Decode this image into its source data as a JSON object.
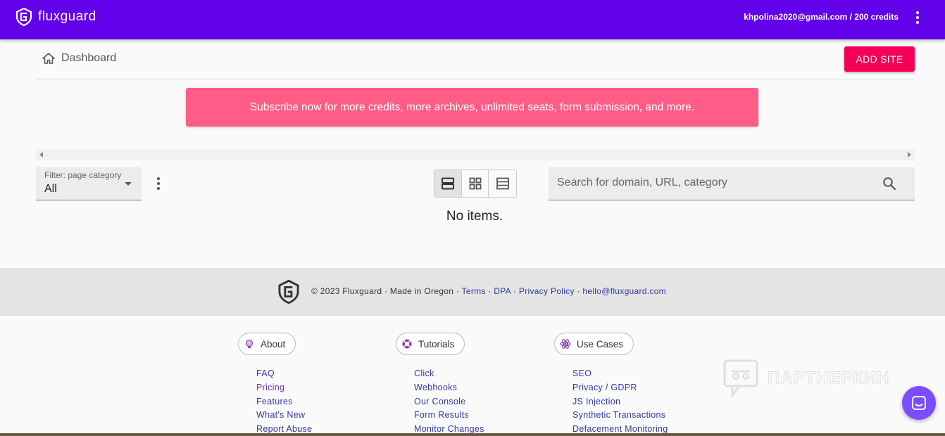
{
  "header": {
    "brand": "fluxguard",
    "account": "khpolina2020@gmail.com / 200 credits",
    "menu_icon": "more-vert-icon"
  },
  "breadcrumb": {
    "icon": "home-icon",
    "label": "Dashboard"
  },
  "actions": {
    "add_site": "ADD SITE"
  },
  "banner": {
    "text": "Subscribe now for more credits, more archives, unlimited seats, form submission, and more."
  },
  "filter": {
    "label": "Filter: page category",
    "value": "All"
  },
  "views": {
    "active": "list-view",
    "icons": [
      "list-view-icon",
      "grid-view-icon",
      "table-view-icon"
    ]
  },
  "search": {
    "placeholder": "Search for domain, URL, category",
    "value": ""
  },
  "empty_state": "No items.",
  "footer": {
    "copyright": "© 2023 Fluxguard · Made in Oregon ·",
    "links": [
      "Terms",
      "DPA",
      "Privacy Policy",
      "hello@fluxguard.com"
    ],
    "sep": "·"
  },
  "footer_columns": [
    {
      "title": "About",
      "icon": "lightbulb-icon",
      "links": [
        "FAQ",
        "Pricing",
        "Features",
        "What's New",
        "Report Abuse"
      ]
    },
    {
      "title": "Tutorials",
      "icon": "lifebuoy-icon",
      "links": [
        "Click",
        "Webhooks",
        "Our Console",
        "Form Results",
        "Monitor Changes"
      ]
    },
    {
      "title": "Use Cases",
      "icon": "atom-icon",
      "links": [
        "SEO",
        "Privacy / GDPR",
        "JS Injection",
        "Synthetic Transactions",
        "Defacement Monitoring"
      ]
    }
  ],
  "watermark": "ПАРТНЕРКИН",
  "colors": {
    "header": "#6200ea",
    "accent": "#f50057",
    "banner": "#ff5d87",
    "chat": "#7c4dff",
    "link": "#303aa8"
  }
}
